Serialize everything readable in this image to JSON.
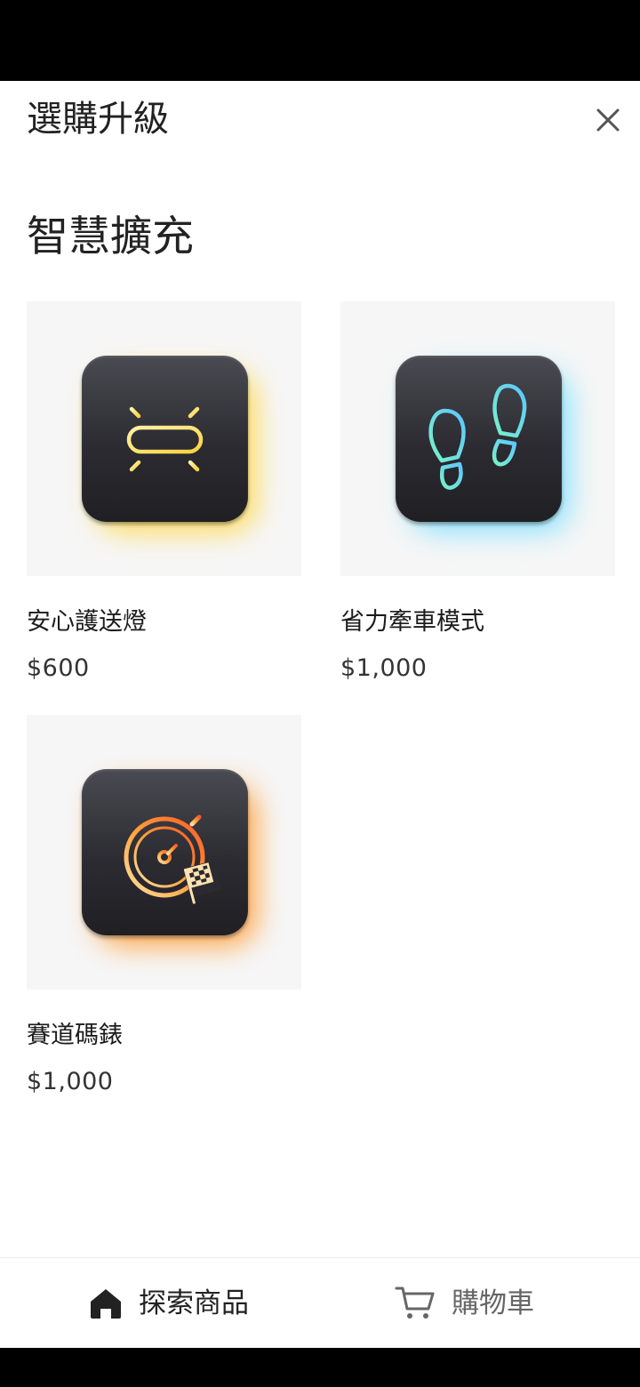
{
  "sheet": {
    "title": "選購升級",
    "close_icon": "close-icon"
  },
  "section": {
    "heading": "智慧擴充"
  },
  "products": [
    {
      "name": "安心護送燈",
      "price": "$600",
      "icon": "light-bar-icon",
      "glow_color": "#ffd84a"
    },
    {
      "name": "省力牽車模式",
      "price": "$1,000",
      "icon": "footprints-icon",
      "glow_color": "#7fe0ff"
    },
    {
      "name": "賽道碼錶",
      "price": "$1,000",
      "icon": "stopwatch-flag-icon",
      "glow_color": "#ff9a2e"
    }
  ],
  "nav": {
    "explore_label": "探索商品",
    "explore_icon": "home-icon",
    "cart_label": "購物車",
    "cart_icon": "cart-icon",
    "active_color": "#222222",
    "inactive_color": "#666666"
  }
}
